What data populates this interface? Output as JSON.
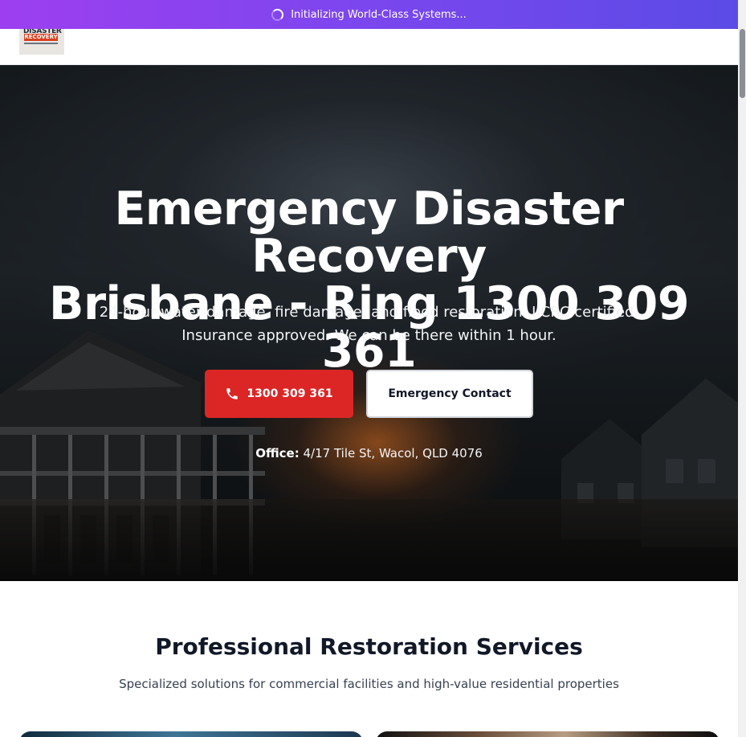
{
  "banner": {
    "text": "Initializing World-Class Systems..."
  },
  "logo": {
    "line1": "DISASTER",
    "line2": "RECOVERY"
  },
  "hero": {
    "title_line1": "Emergency Disaster Recovery",
    "title_line2": "Brisbane - Ring 1300 309 361",
    "subtitle_line1": "24-hour water damage, fire damage, and flood restoration. IICRC certified.",
    "subtitle_line2": "Insurance approved. We can be there within 1 hour.",
    "call_button": "1300 309 361",
    "contact_button": "Emergency Contact",
    "office_label": "Office:",
    "office_address": "4/17 Tile St, Wacol, QLD 4076"
  },
  "services": {
    "title": "Professional Restoration Services",
    "subtitle": "Specialized solutions for commercial facilities and high-value residential properties"
  },
  "colors": {
    "banner_gradient_start": "#9d3ff0",
    "banner_gradient_end": "#5b4be6",
    "call_button": "#dc2626",
    "text_dark": "#111827"
  }
}
